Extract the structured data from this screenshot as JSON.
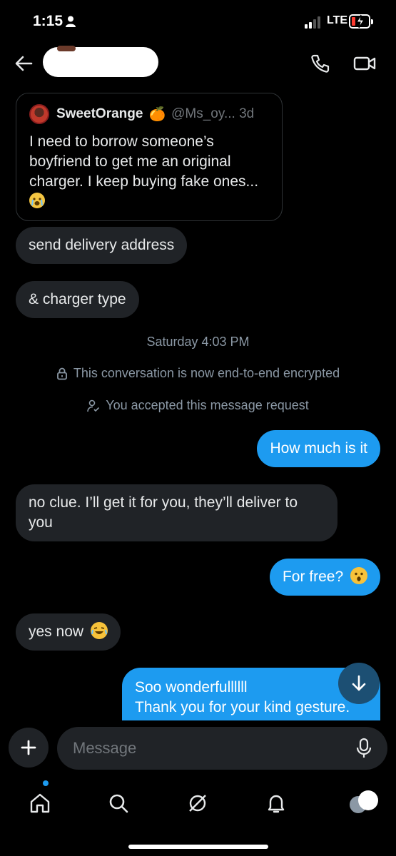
{
  "status": {
    "time": "1:15",
    "network": "LTE"
  },
  "quote": {
    "name": "SweetOrange",
    "emoji": "🍊",
    "handle": "@Ms_oy... 3d",
    "text": "I need to borrow someone’s boyfriend to get me an original charger. I keep buying fake ones..."
  },
  "messages": {
    "m1": "send delivery address",
    "m2": "& charger type",
    "m3": "How much is it",
    "m4_line1": "no clue. I’ll get it for you, they’ll deliver to",
    "m4_line2": "you",
    "m5": "For free?",
    "m6": "yes now",
    "m7_line1": "Soo wonderfullllll",
    "m7_line2": "Thank you for your kind gesture."
  },
  "meta": {
    "timestamp": "Saturday 4:03 PM",
    "encrypted": "This conversation is now end-to-end encrypted",
    "accepted": "You accepted this message request"
  },
  "composer": {
    "placeholder": "Message"
  },
  "colors": {
    "accent": "#1d9bf0",
    "incoming": "#202327",
    "background": "#000000"
  }
}
